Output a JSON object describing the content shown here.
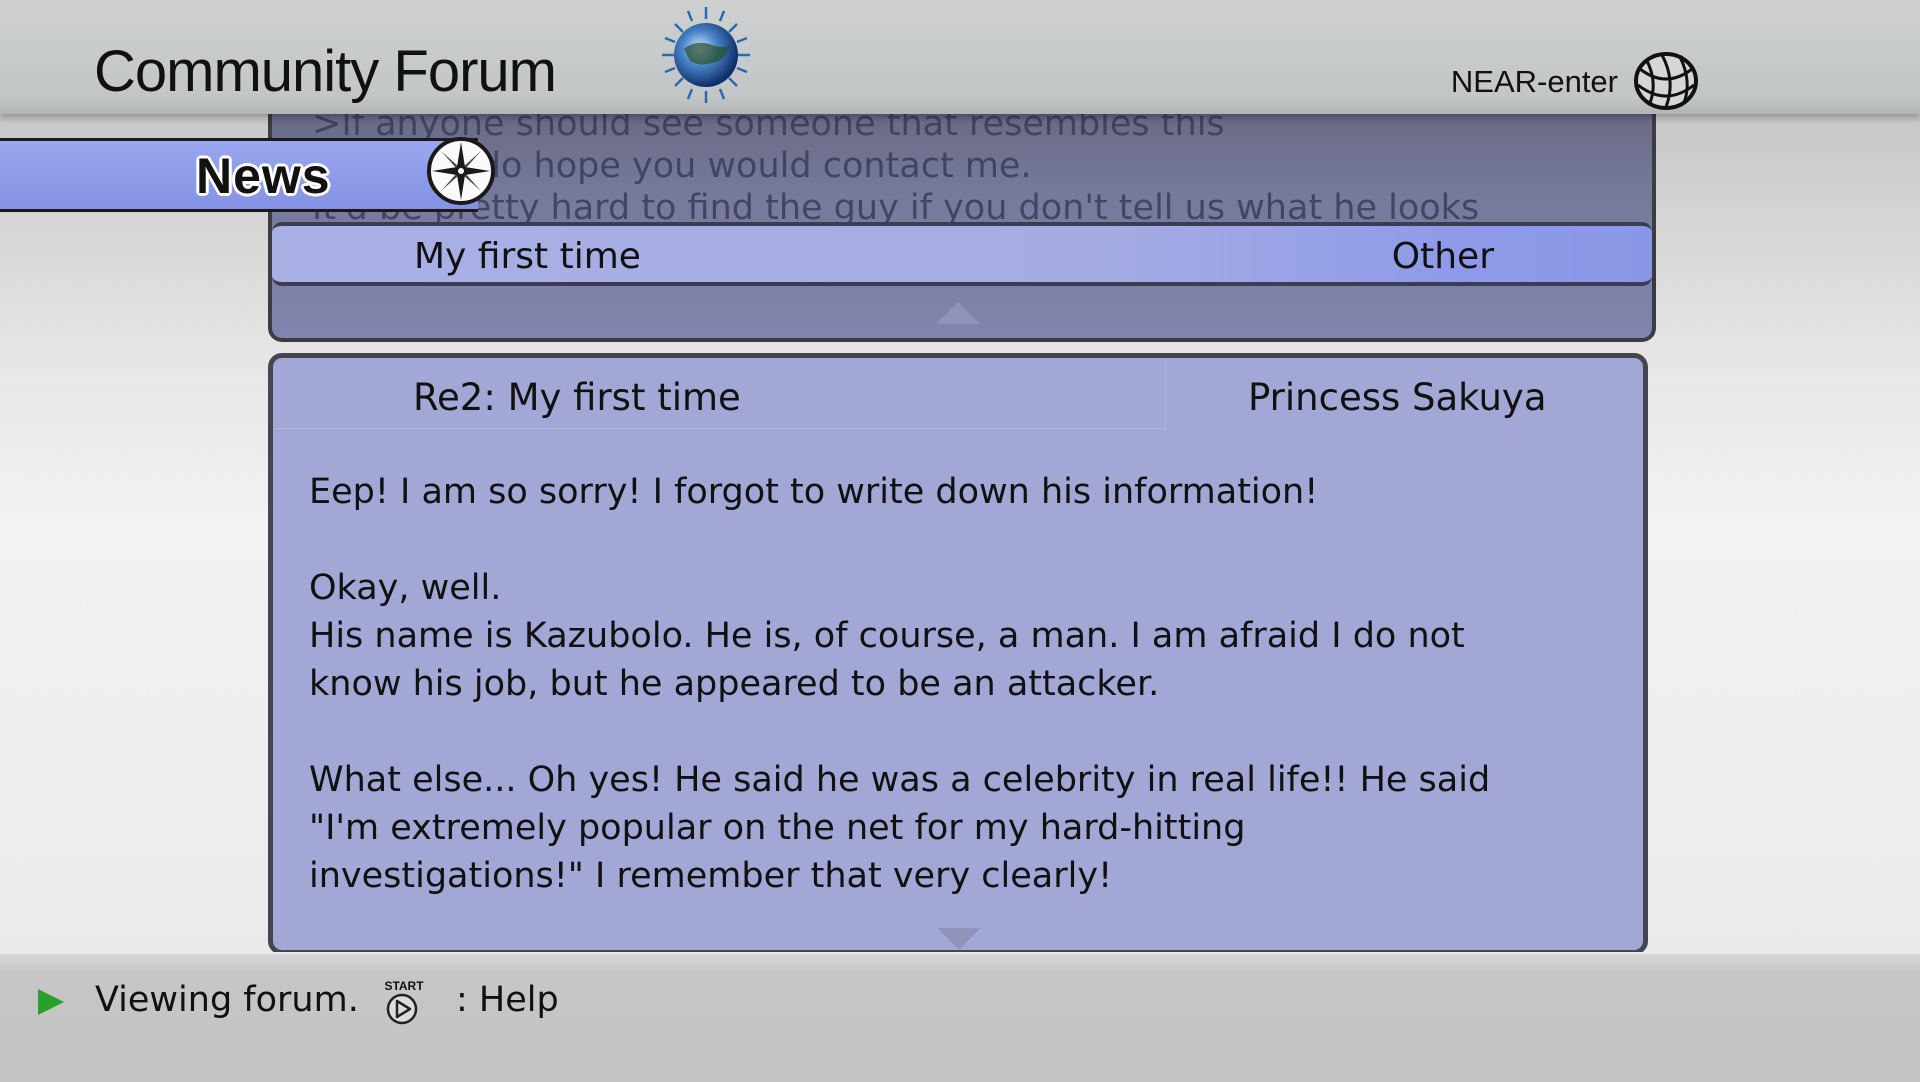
{
  "header": {
    "title": "Community Forum",
    "connection_status": "NEAR-enter",
    "logo_icon": "globe-logo",
    "network_icon": "net-sphere-icon"
  },
  "section_tab": {
    "label": "News",
    "icon": "compass-icon",
    "color": "#8c98e8"
  },
  "thread_list": {
    "faded_lines": [
      ">If anyone should see someone that resembles this",
      ">I do hope you would contact me.",
      "It'd be pretty hard to find the guy if you don't tell us what he looks"
    ],
    "selected_thread": {
      "title": "My first time",
      "category": "Other"
    }
  },
  "post": {
    "title": "Re2: My first time",
    "author": "Princess Sakuya",
    "body": {
      "line1": "Eep! I am so sorry! I forgot to write down his information!",
      "line2": "Okay, well.",
      "line3": "His name is Kazubolo. He is, of course, a man. I am afraid I do not",
      "line4": "know his job, but he appeared to be an attacker.",
      "line5": "What else... Oh yes! He said he was a celebrity in real life!! He said",
      "line6": "\"I'm extremely popular on the net for my hard-hitting",
      "line7": "investigations!\" I remember that very clearly!"
    },
    "panel_color": "#a3a7d6"
  },
  "footer": {
    "status": "Viewing forum.",
    "button_icon": "start-button-icon",
    "help_label": ": Help"
  }
}
